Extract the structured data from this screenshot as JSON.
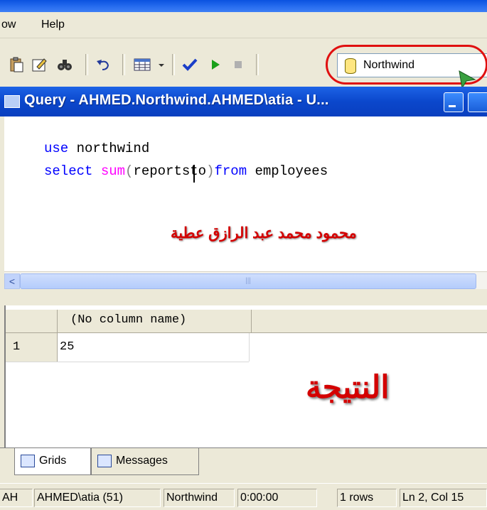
{
  "menu": {
    "items": [
      "ow",
      "Help"
    ]
  },
  "toolbar": {
    "icons": [
      "paste-icon",
      "edit-icon",
      "find-icon",
      "undo-icon",
      "grid-results-icon",
      "dropdown-arrow-icon",
      "check-icon",
      "execute-icon",
      "stop-icon"
    ],
    "database": "Northwind"
  },
  "query_window": {
    "title": "Query - AHMED.Northwind.AHMED\\atia - U..."
  },
  "editor": {
    "line1_kw": "use",
    "line1_rest": " northwind",
    "line2_kw": "select",
    "line2_fn": "sum",
    "line2_open": "(",
    "line2_arg": "reportsto",
    "line2_close": ")",
    "line2_from": "from",
    "line2_rest": " employees",
    "annotation": "محمود محمد عبد الرازق عطية"
  },
  "results": {
    "column_header": "(No column name)",
    "rows": [
      {
        "num": "1",
        "value": "25"
      }
    ],
    "annotation": "النتيجة"
  },
  "tabs": [
    {
      "label": "Grids"
    },
    {
      "label": "Messages"
    }
  ],
  "statusbar": {
    "server": "AH",
    "user": "AHMED\\atia (51)",
    "database": "Northwind",
    "elapsed": "0:00:00",
    "rows": "1 rows",
    "position": "Ln 2, Col 15"
  },
  "colors": {
    "keyword": "#0000ff",
    "function": "#ff00ff",
    "annotation_red": "#d40000",
    "title_blue": "#0b47cc"
  }
}
